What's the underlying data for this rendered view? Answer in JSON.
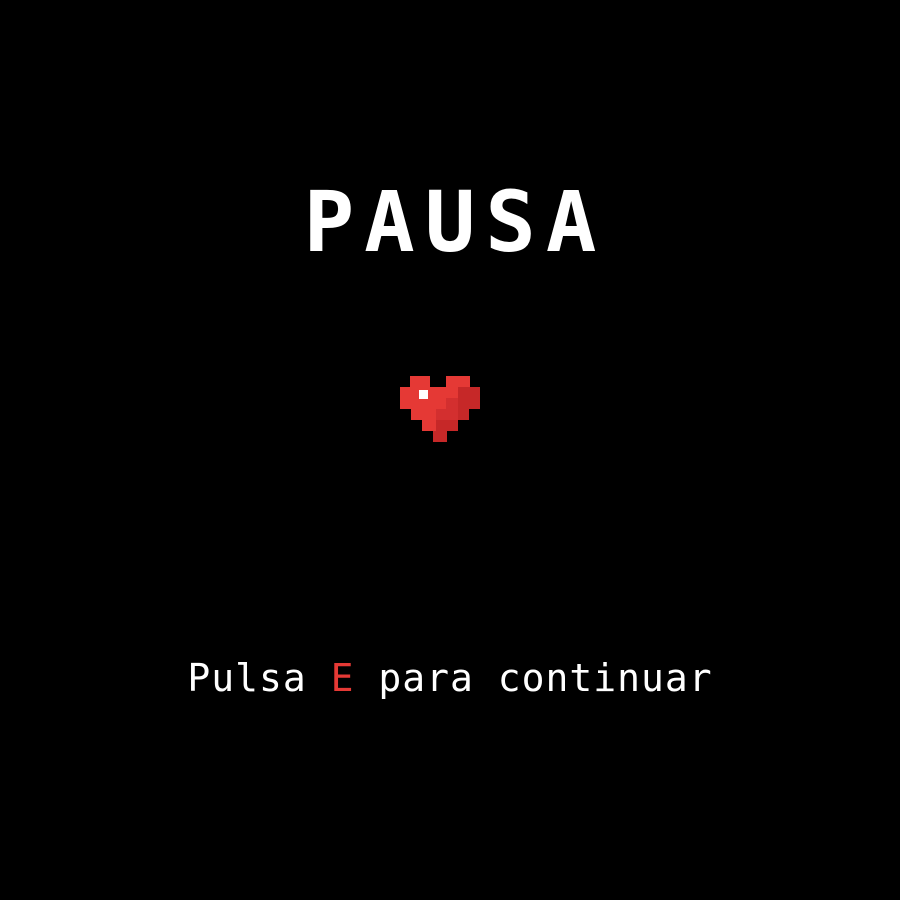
{
  "pause_screen": {
    "title": "PAUSA",
    "hint": {
      "before": "Pulsa ",
      "key": "E",
      "after": " para continuar"
    },
    "heart_icon": "pixel-heart-icon"
  },
  "colors": {
    "background": "#000000",
    "text": "#ffffff",
    "accent": "#e53935",
    "heart_main": "#e53935",
    "heart_shade": "#c62828",
    "heart_highlight": "#ffffff"
  }
}
